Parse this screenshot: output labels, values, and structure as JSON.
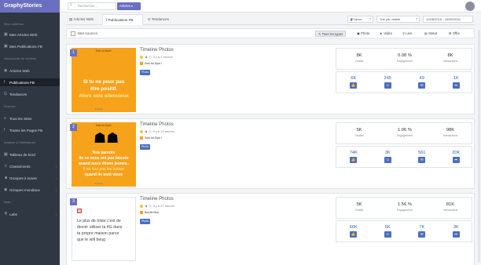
{
  "app": {
    "brand": "GraphyStories"
  },
  "sidebar": {
    "groups": [
      {
        "title": "Mes contenus"
      },
      {
        "title": "Découverte de contenu"
      },
      {
        "title": "Sources"
      },
      {
        "title": "Analyse & Statistiques"
      },
      {
        "title": "Beta"
      }
    ],
    "items": [
      {
        "label": "Mes Articles Web",
        "icon": "folder"
      },
      {
        "label": "Mes Publications FB",
        "icon": "folder"
      },
      {
        "label": "Articles Web",
        "icon": "globe"
      },
      {
        "label": "Publications FB",
        "icon": "facebook"
      },
      {
        "label": "Tendances",
        "icon": "google"
      },
      {
        "label": "Tous les Sites",
        "icon": "list"
      },
      {
        "label": "Toutes les Pages FB",
        "icon": "facebook"
      },
      {
        "label": "Tableau de bord",
        "icon": "dashboard"
      },
      {
        "label": "Classements",
        "icon": "trophy"
      },
      {
        "label": "Groupes à suivre",
        "icon": "users"
      },
      {
        "label": "Groupes mondiaux",
        "icon": "globe"
      },
      {
        "label": "Labs",
        "icon": "flask"
      }
    ]
  },
  "topbar": {
    "search_placeholder": "Rechercher...",
    "select_label": "Articles"
  },
  "tabs": [
    {
      "label": "Articles Web"
    },
    {
      "label": "Publications FB"
    },
    {
      "label": "Tendances"
    }
  ],
  "filters": {
    "country": "France",
    "sort": "Trié par viralité",
    "date_range": "12/08/2016 - 16/08/2016"
  },
  "toolbar": {
    "select_all": "Mes sources",
    "buttons": [
      "Tous les types",
      "Photo",
      "Vidéo",
      "Lien",
      "Statut",
      "Offre"
    ]
  },
  "posts": [
    {
      "num": "1",
      "title": "Timeline Photos",
      "age": "Il y a 2 heures",
      "page": "Sois toi-Syst !",
      "type": "Photo",
      "thumb_tag": "Sois toi-Syst !",
      "thumb_lines": [
        "Si tu ne peux pas",
        "être positif.",
        "Alors sois silencieux"
      ],
      "metrics": [
        {
          "value": "8K",
          "label": "Viralité"
        },
        {
          "value": "0.08 %",
          "label": "Engagement"
        },
        {
          "value": "8K",
          "label": "Interactions"
        }
      ],
      "reacts": [
        {
          "value": "6K",
          "icon": "like"
        },
        {
          "value": "245",
          "icon": "wow"
        },
        {
          "value": "49",
          "icon": "comment"
        },
        {
          "value": "1K",
          "icon": "share"
        }
      ]
    },
    {
      "num": "2",
      "title": "Timeline Photos",
      "age": "Il y a 19 heures",
      "page": "Sois toi-Syst !",
      "type": "Photo",
      "thumb_tag": "Sois toi-Syst !",
      "thumb_lines": [
        "Nos parents",
        "Ils ne nous ont pas laissés",
        "quand nous étions jeunes..",
        "Il ne faut pas les laisser",
        "quand ils sont vieux"
      ],
      "metrics": [
        {
          "value": "5K",
          "label": "Viralité"
        },
        {
          "value": "1.06 %",
          "label": "Engagement"
        },
        {
          "value": "98K",
          "label": "Interactions"
        }
      ],
      "reacts": [
        {
          "value": "74K",
          "icon": "like"
        },
        {
          "value": "3K",
          "icon": "wow"
        },
        {
          "value": "561",
          "icon": "comment"
        },
        {
          "value": "20K",
          "icon": "share"
        }
      ]
    },
    {
      "num": "3",
      "title": "Timeline Photos",
      "age": "Il y a 27 heures",
      "page": "Bordel Mon",
      "type": "Photo",
      "thumb_lines": [
        "Le plus de triste c'est de",
        "devoir utiliser ta 4G dans",
        "ta propre maison parce",
        "que le wifi beug"
      ],
      "metrics": [
        {
          "value": "5K",
          "label": "Viralité"
        },
        {
          "value": "1.56 %",
          "label": "Engagement"
        },
        {
          "value": "81K",
          "label": "Interactions"
        }
      ],
      "reacts": [
        {
          "value": "66K",
          "icon": "like"
        },
        {
          "value": "5K",
          "icon": "wow"
        },
        {
          "value": "7K",
          "icon": "comment"
        },
        {
          "value": "3K",
          "icon": "share"
        }
      ]
    }
  ]
}
